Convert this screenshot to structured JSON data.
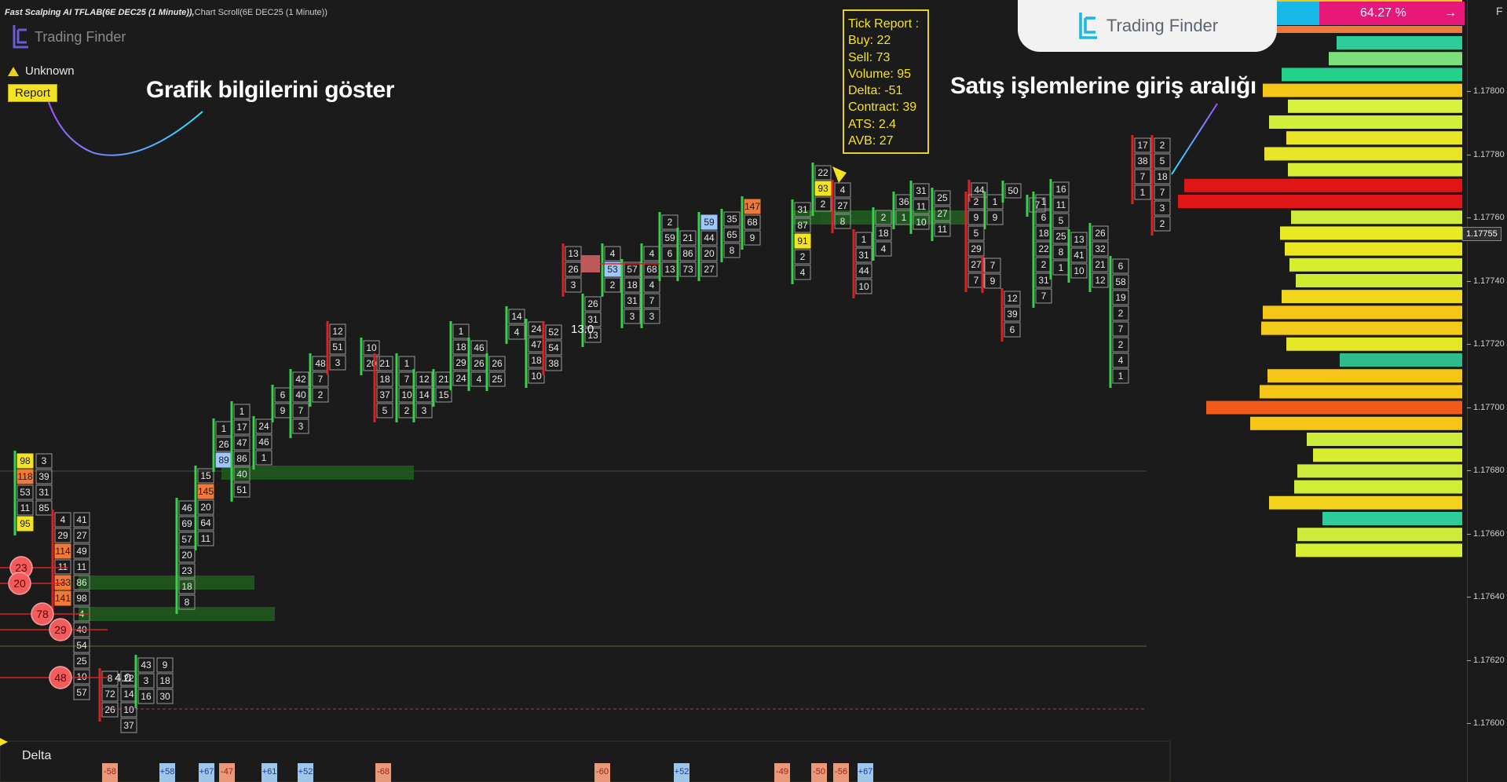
{
  "header": {
    "title": "Fast Scalping AI TFLAB(6E DEC25 (1 Minute)),",
    "subtitle": "Chart Scroll(6E DEC25 (1 Minute))",
    "brand_small": "Trading Finder",
    "status_text": "Unknown",
    "report_button": "Report"
  },
  "brand_top": {
    "name": "Trading Finder",
    "pct_left": "%",
    "pct_right": "64.27 %"
  },
  "captions": {
    "left": "Grafik bilgilerini göster",
    "right": "Satış işlemlerine giriş aralığı"
  },
  "tick_report": {
    "title": "Tick Report :",
    "lines": [
      "Buy: 22",
      "Sell: 73",
      "Volume: 95",
      "Delta: -51",
      "Contract: 39",
      "ATS: 2.4",
      "AVB: 27"
    ]
  },
  "colors": {
    "bg": "#1b1b1b",
    "up": "#35d24a",
    "down": "#e02020",
    "highlight": "#f5e321",
    "zone": "#1f5a1f"
  },
  "price_axis": {
    "labels": [
      "1.17800",
      "1.17780",
      "1.17760",
      "1.17740",
      "1.17720",
      "1.17700",
      "1.17680",
      "1.17660",
      "1.17640",
      "1.17620",
      "1.17600"
    ],
    "current": "1.17755",
    "corner": "F"
  },
  "delta_panel": {
    "label": "Delta",
    "bars": [
      {
        "label": "-58",
        "sign": -1
      },
      {
        "label": "+58",
        "sign": 1
      },
      {
        "label": "+67",
        "sign": 1
      },
      {
        "label": "-47",
        "sign": -1
      },
      {
        "label": "+61",
        "sign": 1
      },
      {
        "label": "+52",
        "sign": 1
      },
      {
        "label": "-68",
        "sign": -1
      },
      {
        "label": "-60",
        "sign": -1
      },
      {
        "label": "+52",
        "sign": 1
      },
      {
        "label": "-49",
        "sign": -1
      },
      {
        "label": "-50",
        "sign": -1
      },
      {
        "label": "-56",
        "sign": -1
      },
      {
        "label": "+67",
        "sign": 1
      }
    ]
  },
  "chart_data": {
    "type": "footprint",
    "zones": [
      {
        "label": "buy-zone-1"
      },
      {
        "label": "buy-zone-2"
      },
      {
        "label": "buy-zone-3"
      },
      {
        "label": "buy-zone-4"
      },
      {
        "label": "sell-zone"
      }
    ],
    "large_trades": [
      "23",
      "20",
      "78",
      "29",
      "48"
    ],
    "ghost_labels": [
      "13.0",
      "4.0"
    ],
    "columns": [
      {
        "dir": "up",
        "cells": [
          "98",
          "118",
          "53",
          "11",
          "95"
        ],
        "right": [
          "3",
          "39",
          "31",
          "85"
        ]
      },
      {
        "dir": "down",
        "cells": [
          "4",
          "29",
          "114",
          "11",
          "133",
          "141"
        ],
        "right": [
          "41",
          "27",
          "49",
          "11",
          "86",
          "98",
          "4",
          "40",
          "54",
          "25",
          "10",
          "57"
        ]
      },
      {
        "dir": "down",
        "cells": [
          "8",
          "72",
          "26"
        ],
        "right": [
          "22",
          "14",
          "10",
          "37"
        ]
      },
      {
        "dir": "up",
        "cells": [
          "43",
          "3",
          "16"
        ],
        "right": [
          "9",
          "18",
          "30"
        ]
      },
      {
        "dir": "up",
        "cells": [
          "46",
          "69",
          "57",
          "20",
          "23",
          "18",
          "8"
        ],
        "right": []
      },
      {
        "dir": "up",
        "cells": [
          "15",
          "145",
          "20",
          "64",
          "11"
        ],
        "right": []
      },
      {
        "dir": "up",
        "cells": [
          "1",
          "26",
          "89"
        ],
        "right": []
      },
      {
        "dir": "up",
        "cells": [
          "1",
          "17",
          "47",
          "86",
          "40",
          "51"
        ],
        "right": []
      },
      {
        "dir": "up",
        "cells": [
          "24",
          "46",
          "1"
        ],
        "right": []
      },
      {
        "dir": "up",
        "cells": [
          "6",
          "9"
        ],
        "right": []
      },
      {
        "dir": "up",
        "cells": [
          "42",
          "40",
          "7",
          "3"
        ],
        "right": []
      },
      {
        "dir": "up",
        "cells": [
          "48",
          "7",
          "2"
        ],
        "right": []
      },
      {
        "dir": "down",
        "cells": [
          "12",
          "51",
          "3"
        ],
        "right": []
      },
      {
        "dir": "up",
        "cells": [
          "10",
          "20"
        ],
        "right": []
      },
      {
        "dir": "down",
        "cells": [
          "21",
          "18",
          "37",
          "5"
        ],
        "right": []
      },
      {
        "dir": "up",
        "cells": [
          "1",
          "7",
          "10",
          "2"
        ],
        "right": []
      },
      {
        "dir": "up",
        "cells": [
          "12",
          "14",
          "3"
        ],
        "right": []
      },
      {
        "dir": "up",
        "cells": [
          "21",
          "15"
        ],
        "right": []
      },
      {
        "dir": "up",
        "cells": [
          "1",
          "18",
          "29",
          "24"
        ],
        "right": []
      },
      {
        "dir": "up",
        "cells": [
          "46",
          "26",
          "4"
        ],
        "right": []
      },
      {
        "dir": "up",
        "cells": [
          "26",
          "25"
        ],
        "right": []
      },
      {
        "dir": "up",
        "cells": [
          "14",
          "4"
        ],
        "right": []
      },
      {
        "dir": "up",
        "cells": [
          "24",
          "47",
          "18",
          "10"
        ],
        "right": []
      },
      {
        "dir": "down",
        "cells": [
          "52",
          "54",
          "38"
        ],
        "right": []
      },
      {
        "dir": "down",
        "cells": [
          "13",
          "26",
          "3"
        ],
        "right": []
      },
      {
        "dir": "up",
        "cells": [
          "26",
          "31",
          "13"
        ],
        "right": []
      },
      {
        "dir": "up",
        "cells": [
          "4",
          "53",
          "2"
        ],
        "right": []
      },
      {
        "dir": "up",
        "cells": [
          "57",
          "18",
          "31",
          "3"
        ],
        "right": []
      },
      {
        "dir": "up",
        "cells": [
          "4",
          "68",
          "4",
          "7",
          "3"
        ],
        "right": []
      },
      {
        "dir": "up",
        "cells": [
          "2",
          "59",
          "6",
          "13"
        ],
        "right": []
      },
      {
        "dir": "up",
        "cells": [
          "21",
          "86",
          "73"
        ],
        "right": []
      },
      {
        "dir": "up",
        "cells": [
          "59",
          "44",
          "20",
          "27"
        ],
        "right": []
      },
      {
        "dir": "up",
        "cells": [
          "35",
          "65",
          "8"
        ],
        "right": []
      },
      {
        "dir": "up",
        "cells": [
          "147",
          "68",
          "9"
        ],
        "right": []
      },
      {
        "dir": "up",
        "cells": [
          "31",
          "87",
          "91",
          "2",
          "4"
        ],
        "right": []
      },
      {
        "dir": "up",
        "cells": [
          "22",
          "93",
          "2"
        ],
        "right": []
      },
      {
        "dir": "down",
        "cells": [
          "4",
          "27",
          "8"
        ],
        "right": []
      },
      {
        "dir": "down",
        "cells": [
          "1",
          "31",
          "44",
          "10"
        ],
        "right": []
      },
      {
        "dir": "up",
        "cells": [
          "2",
          "18",
          "4"
        ],
        "right": []
      },
      {
        "dir": "up",
        "cells": [
          "36",
          "1"
        ],
        "right": []
      },
      {
        "dir": "up",
        "cells": [
          "31",
          "11",
          "10"
        ],
        "right": []
      },
      {
        "dir": "up",
        "cells": [
          "25",
          "27",
          "11"
        ],
        "right": []
      },
      {
        "dir": "down",
        "cells": [
          "44"
        ],
        "right": []
      },
      {
        "dir": "up",
        "cells": [
          "1",
          "9"
        ],
        "right": []
      },
      {
        "dir": "up",
        "cells": [
          "50"
        ],
        "right": []
      },
      {
        "dir": "down",
        "cells": [
          "2",
          "9",
          "5",
          "29",
          "27",
          "7"
        ],
        "right": []
      },
      {
        "dir": "down",
        "cells": [
          "7",
          "9"
        ],
        "right": []
      },
      {
        "dir": "down",
        "cells": [
          "12",
          "39",
          "6"
        ],
        "right": []
      },
      {
        "dir": "up",
        "cells": [
          "7"
        ],
        "right": []
      },
      {
        "dir": "up",
        "cells": [
          "1",
          "6",
          "18",
          "22",
          "2",
          "31",
          "7"
        ],
        "right": []
      },
      {
        "dir": "up",
        "cells": [
          "16",
          "11",
          "5",
          "25",
          "8",
          "1"
        ],
        "right": []
      },
      {
        "dir": "up",
        "cells": [
          "13",
          "41",
          "10"
        ],
        "right": []
      },
      {
        "dir": "up",
        "cells": [
          "26",
          "32",
          "21",
          "12"
        ],
        "right": []
      },
      {
        "dir": "up",
        "cells": [
          "6",
          "58",
          "19",
          "2",
          "7",
          "2",
          "4",
          "1"
        ],
        "right": []
      },
      {
        "dir": "down",
        "cells": [
          "17",
          "38",
          "7",
          "1"
        ],
        "right": []
      },
      {
        "dir": "down",
        "cells": [
          "2",
          "5",
          "18",
          "7",
          "3",
          "2"
        ],
        "right": []
      }
    ],
    "volume_profile": [
      {
        "color": "#2ecc9a"
      },
      {
        "color": "#7be07b"
      },
      {
        "color": "#23d18a"
      },
      {
        "color": "#f5c518"
      },
      {
        "color": "#d6f23a"
      },
      {
        "color": "#cfef38"
      },
      {
        "color": "#e9e625"
      },
      {
        "color": "#e8e528"
      },
      {
        "color": "#d8ee33"
      },
      {
        "color": "#e01515"
      },
      {
        "color": "#e01515"
      },
      {
        "color": "#cdeb3a"
      },
      {
        "color": "#eaea22"
      },
      {
        "color": "#e9e620"
      },
      {
        "color": "#d7ee2f"
      },
      {
        "color": "#cdeb33"
      },
      {
        "color": "#f0d91b"
      },
      {
        "color": "#f5c518"
      },
      {
        "color": "#f3c91a"
      },
      {
        "color": "#e6e627"
      },
      {
        "color": "#2ebd8a"
      },
      {
        "color": "#f5c518"
      },
      {
        "color": "#f5c518"
      },
      {
        "color": "#f25a1a"
      },
      {
        "color": "#f5c518"
      },
      {
        "color": "#cdeb3a"
      },
      {
        "color": "#d6ee2e"
      },
      {
        "color": "#cdeb3a"
      },
      {
        "color": "#cfee36"
      },
      {
        "color": "#f3d31c"
      },
      {
        "color": "#2ecc9a"
      },
      {
        "color": "#cdeb3a"
      },
      {
        "color": "#d8ee33"
      }
    ]
  }
}
